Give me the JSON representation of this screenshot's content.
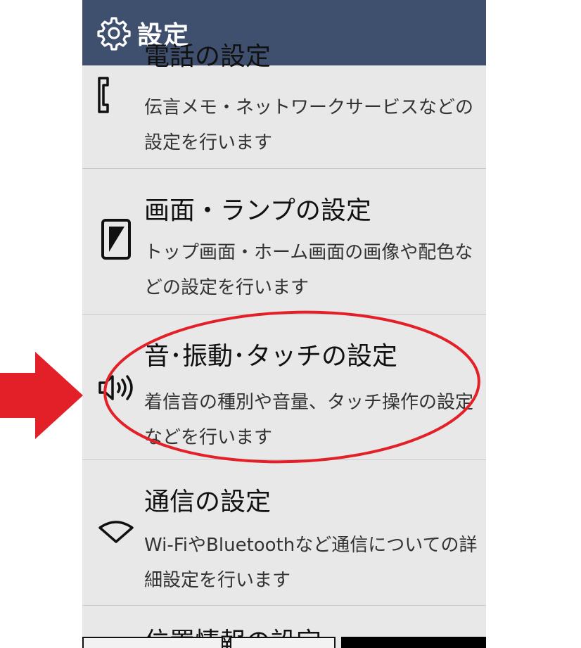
{
  "header": {
    "title": "設定",
    "icon": "gear-icon"
  },
  "items": [
    {
      "title": "電話の設定",
      "desc": "伝言メモ・ネットワークサービスなどの設定を行います",
      "icon": "phone-icon"
    },
    {
      "title": "画面・ランプの設定",
      "desc": "トップ画面・ホーム画面の画像や配色などの設定を行います",
      "icon": "screen-icon"
    },
    {
      "title": "音･振動･タッチの設定",
      "desc": "着信音の種別や音量、タッチ操作の設定などを行います",
      "icon": "speaker-icon"
    },
    {
      "title": "通信の設定",
      "desc": "Wi-FiやBluetoothなど通信についての詳細設定を行います",
      "icon": "wifi-icon"
    },
    {
      "title": "位置情報の設定",
      "icon": "location-icon"
    }
  ],
  "colors": {
    "header": "#3f4f6e",
    "annotation": "#e32028",
    "background": "#e8e8e8"
  }
}
